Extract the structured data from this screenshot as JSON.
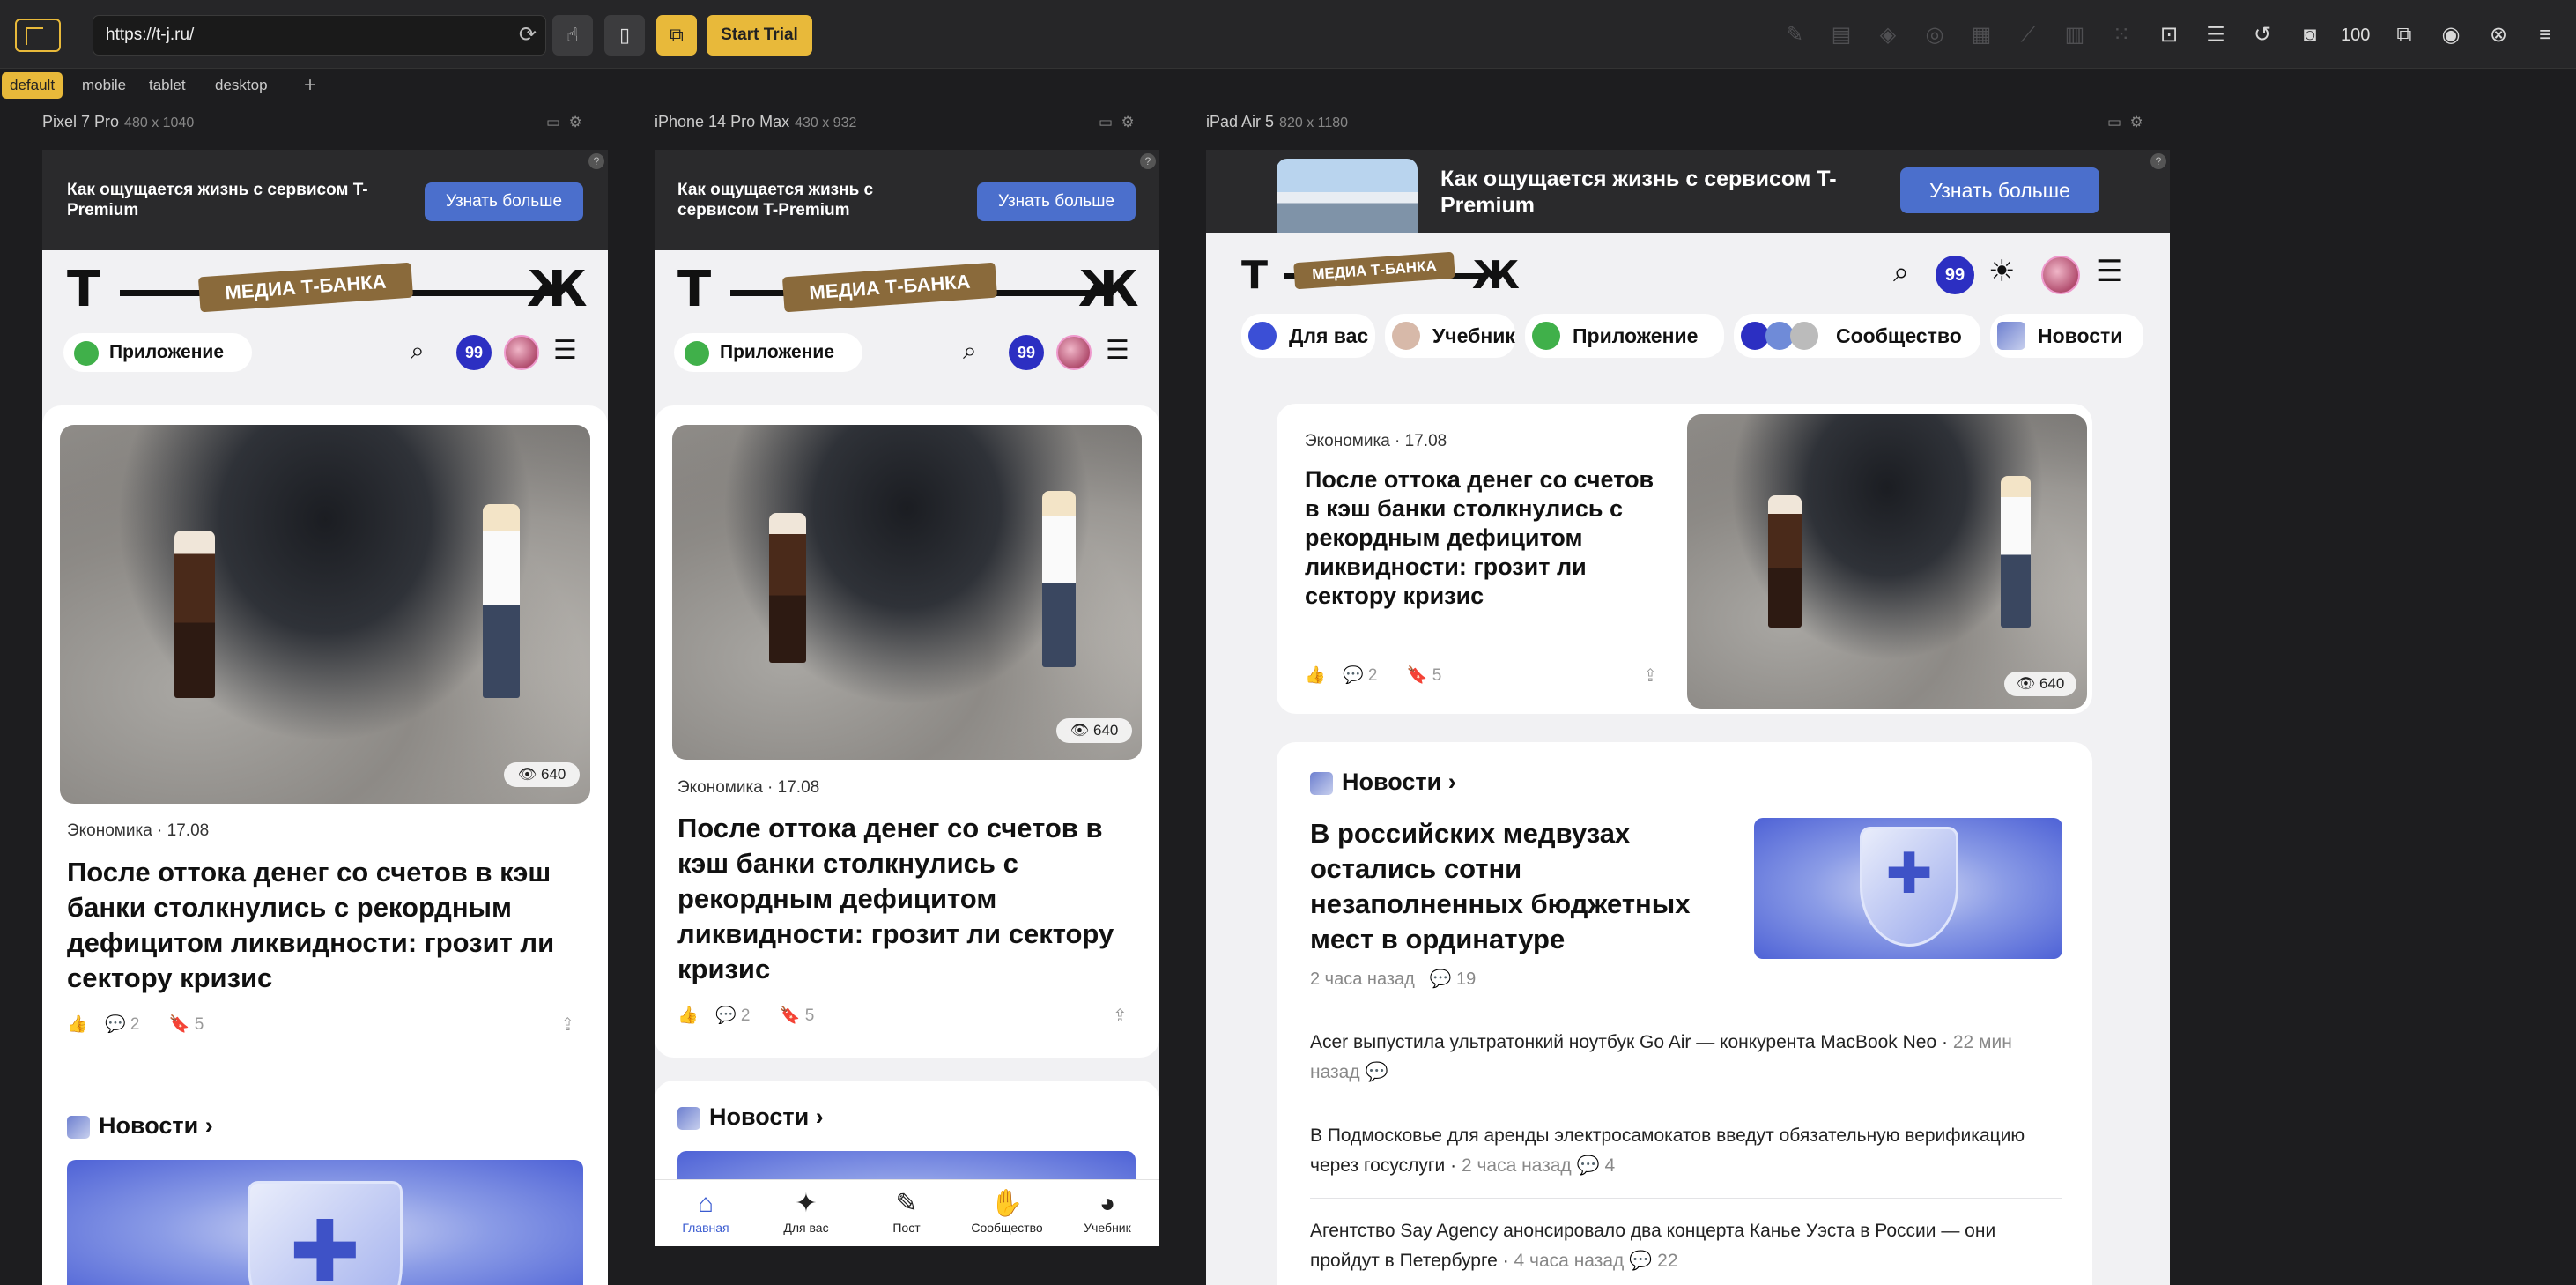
{
  "toolbar": {
    "url": "https://t-j.ru/",
    "start_trial": "Start Trial",
    "zoom": "100"
  },
  "tabs": [
    "default",
    "mobile",
    "tablet",
    "desktop"
  ],
  "devices": [
    {
      "name": "Pixel 7 Pro",
      "dims": "480 x 1040"
    },
    {
      "name": "iPhone 14 Pro Max",
      "dims": "430 x 932"
    },
    {
      "name": "iPad Air 5",
      "dims": "820 x 1180"
    }
  ],
  "site": {
    "banner_text": "Как ощущается жизнь с сервисом T-Premium",
    "banner_button": "Узнать больше",
    "logo_badge": "МЕДИА Т-БАНКА",
    "app_pill": "Приложение",
    "counter": "99",
    "nav": [
      "Для вас",
      "Учебник",
      "Приложение",
      "Сообщество",
      "Новости"
    ],
    "featured": {
      "meta": "Экономика · 17.08",
      "title": "После оттока денег со счетов в кэш банки столкнулись с рекордным дефицитом ликвидности: грозит ли сектору кризис",
      "views": "640",
      "comments": "2",
      "bookmarks": "5"
    },
    "news_section": "Новости ›",
    "news": {
      "main_title": "В российских медвузах остались сотни незаполненных бюджетных мест в ординатуре",
      "main_time": "2 часа назад",
      "main_comments": "19",
      "items": [
        {
          "text": "Acer выпустила ультратонкий ноутбук Go Air — конкурента MacBook Neo ·",
          "time": "22 мин назад",
          "comments": ""
        },
        {
          "text": "В Подмосковье для аренды электросамокатов введут обязательную верификацию через госуслуги ·",
          "time": "2 часа назад",
          "comments": "4"
        },
        {
          "text": "Агентство Say Agency анонсировало два концерта Канье Уэста в России — они пройдут в Петербурге ·",
          "time": "4 часа назад",
          "comments": "22"
        }
      ]
    },
    "bottom_nav": [
      "Главная",
      "Для вас",
      "Пост",
      "Сообщество",
      "Учебник"
    ]
  }
}
